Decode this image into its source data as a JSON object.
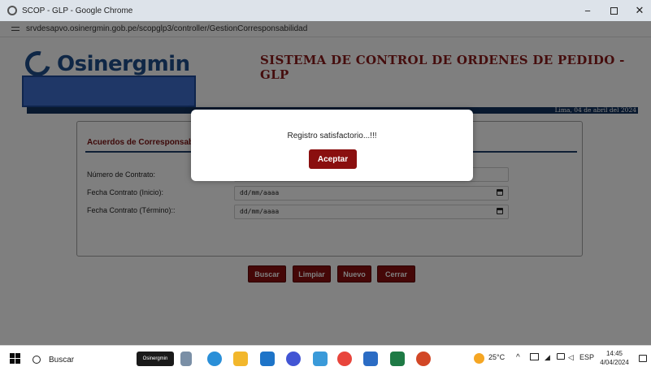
{
  "browser": {
    "window_title": "SCOP - GLP - Google Chrome",
    "url": "srvdesapvo.osinergmin.gob.pe/scopglp3/controller/GestionCorresponsabilidad",
    "minimize": "−",
    "close": "✕"
  },
  "header": {
    "logo_text": "Osinergmin",
    "system_title": "SISTEMA DE CONTROL DE ORDENES DE PEDIDO - GLP",
    "date": "Lima, 04 de abril del 2024"
  },
  "form": {
    "title": "Acuerdos de Corresponsabili",
    "contract_number_label": "Número de Contrato:",
    "start_date_label": "Fecha Contrato (Inicio):",
    "end_date_label": "Fecha Contrato (Término)::",
    "start_date_value": "dd/mm/aaaa",
    "end_date_value": "dd/mm/aaaa",
    "buttons": {
      "search": "Buscar",
      "clear": "Limpiar",
      "new": "Nuevo",
      "close": "Cerrar"
    }
  },
  "modal": {
    "message": "Registro satisfactorio...!!!",
    "accept": "Aceptar"
  },
  "taskbar": {
    "search_label": "Buscar",
    "osinergmin_app": "Osinergmin",
    "temperature": "25°C",
    "language": "ESP",
    "time": "14:45",
    "date": "4/04/2024"
  },
  "colors": {
    "brand_blue": "#1f4e8c",
    "brand_red": "#8a0f0f",
    "navy_bar": "#12335f"
  }
}
